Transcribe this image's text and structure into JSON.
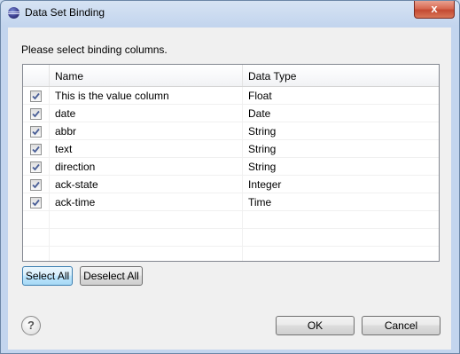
{
  "window": {
    "title": "Data Set Binding",
    "close_label": "x"
  },
  "instruction": "Please select binding columns.",
  "table": {
    "headers": {
      "name": "Name",
      "type": "Data Type"
    },
    "rows": [
      {
        "checked": true,
        "name": "This is the value column",
        "type": "Float"
      },
      {
        "checked": true,
        "name": "date",
        "type": "Date"
      },
      {
        "checked": true,
        "name": "abbr",
        "type": "String"
      },
      {
        "checked": true,
        "name": "text",
        "type": "String"
      },
      {
        "checked": true,
        "name": "direction",
        "type": "String"
      },
      {
        "checked": true,
        "name": "ack-state",
        "type": "Integer"
      },
      {
        "checked": true,
        "name": "ack-time",
        "type": "Time"
      }
    ]
  },
  "buttons": {
    "select_all": "Select All",
    "deselect_all": "Deselect All",
    "ok": "OK",
    "cancel": "Cancel"
  },
  "help": {
    "label": "?"
  },
  "colors": {
    "title_bar": "#c3d5ee",
    "dialog_bg": "#f0f0f0",
    "close_button": "#c44a32",
    "focused_button": "#a7d9f5",
    "check_mark": "#4a5f97"
  }
}
